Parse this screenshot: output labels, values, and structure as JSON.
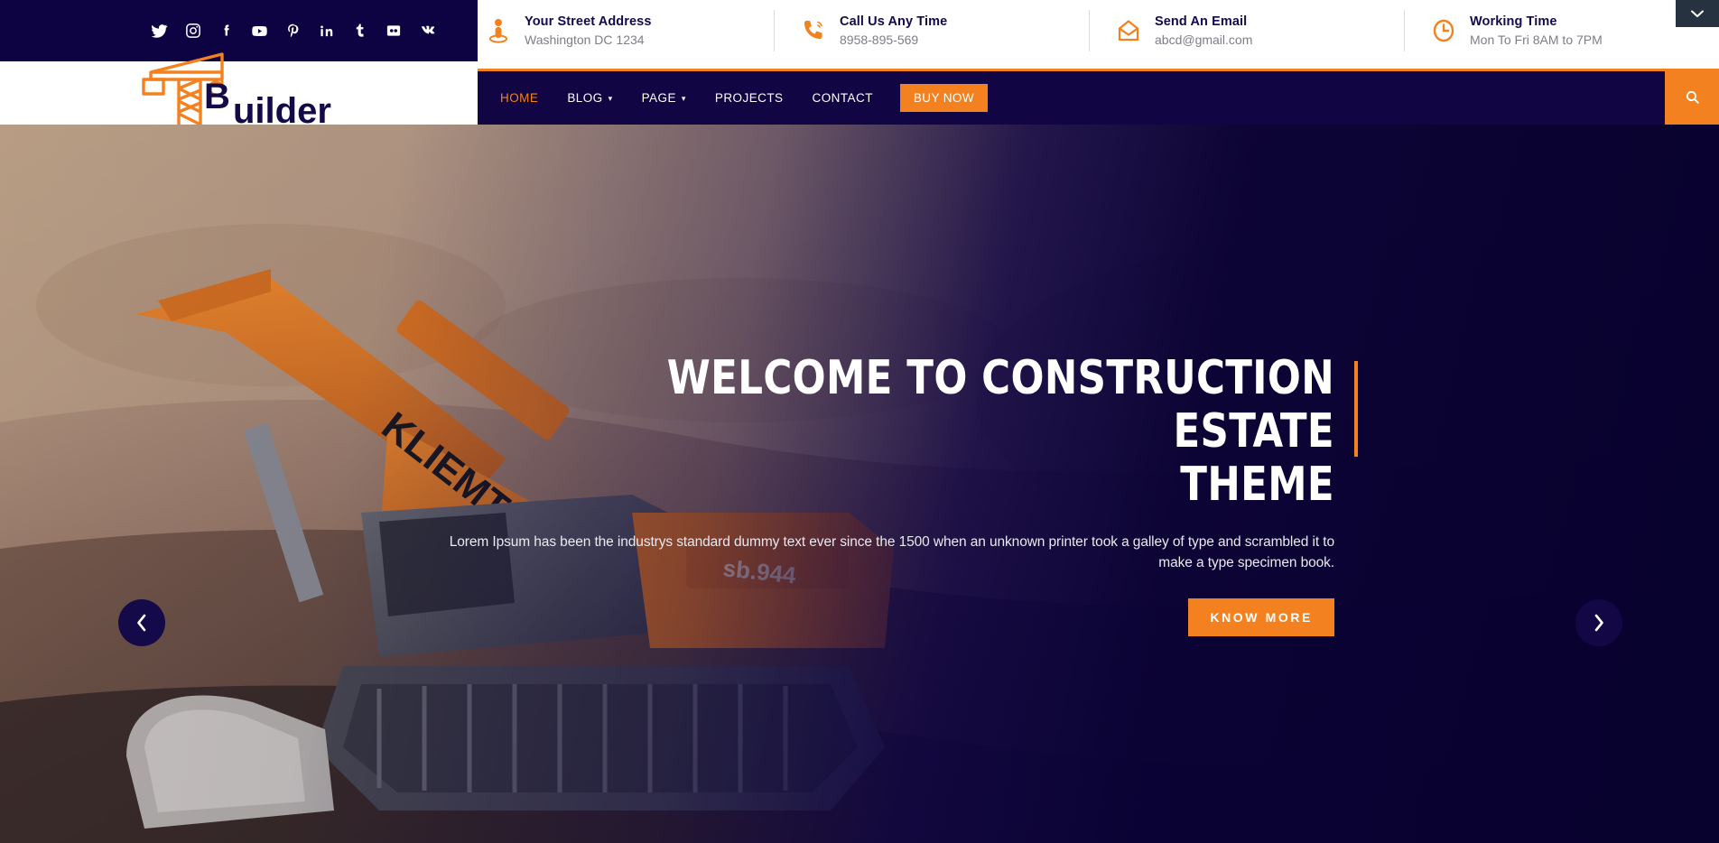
{
  "topbar": {
    "social_icons": [
      {
        "name": "twitter-icon",
        "label": "Twitter"
      },
      {
        "name": "instagram-icon",
        "label": "Instagram"
      },
      {
        "name": "facebook-icon",
        "label": "Facebook"
      },
      {
        "name": "youtube-icon",
        "label": "YouTube"
      },
      {
        "name": "pinterest-icon",
        "label": "Pinterest"
      },
      {
        "name": "linkedin-icon",
        "label": "LinkedIn"
      },
      {
        "name": "tumblr-icon",
        "label": "Tumblr"
      },
      {
        "name": "flickr-icon",
        "label": "Flickr"
      },
      {
        "name": "vk-icon",
        "label": "VK"
      }
    ],
    "contacts": [
      {
        "icon": "location-pin-icon",
        "title": "Your Street Address",
        "value": "Washington DC 1234"
      },
      {
        "icon": "phone-ring-icon",
        "title": "Call Us Any Time",
        "value": "8958-895-569"
      },
      {
        "icon": "envelope-icon",
        "title": "Send An Email",
        "value": "abcd@gmail.com"
      },
      {
        "icon": "clock-icon",
        "title": "Working Time",
        "value": "Mon To Fri 8AM to 7PM"
      }
    ]
  },
  "brand": {
    "name": "Builder",
    "first_letter": "B",
    "rest": "uilder",
    "icon": "crane-icon"
  },
  "nav": {
    "items": [
      {
        "label": "HOME",
        "active": true,
        "has_dropdown": false
      },
      {
        "label": "BLOG",
        "active": false,
        "has_dropdown": true
      },
      {
        "label": "PAGE",
        "active": false,
        "has_dropdown": true
      },
      {
        "label": "PROJECTS",
        "active": false,
        "has_dropdown": false
      },
      {
        "label": "CONTACT",
        "active": false,
        "has_dropdown": false
      }
    ],
    "buy_now_label": "BUY NOW",
    "search_icon": "search-icon",
    "caret_glyph": "▾"
  },
  "hero": {
    "title_line1": "WELCOME TO CONSTRUCTION ESTATE",
    "title_line2": "THEME",
    "description": "Lorem Ipsum has been the industrys standard dummy text ever since the 1500 when an unknown printer took a galley of type and scrambled it to make a type specimen book.",
    "cta_label": "KNOW MORE",
    "prev_arrow": "‹",
    "next_arrow": "›"
  },
  "overlay": {
    "chevron_glyph": "⌄"
  },
  "colors": {
    "navy": "#0d0342",
    "navy_deep": "#120544",
    "orange": "#f4811f",
    "white": "#ffffff",
    "muted_text": "#7d7d87"
  }
}
